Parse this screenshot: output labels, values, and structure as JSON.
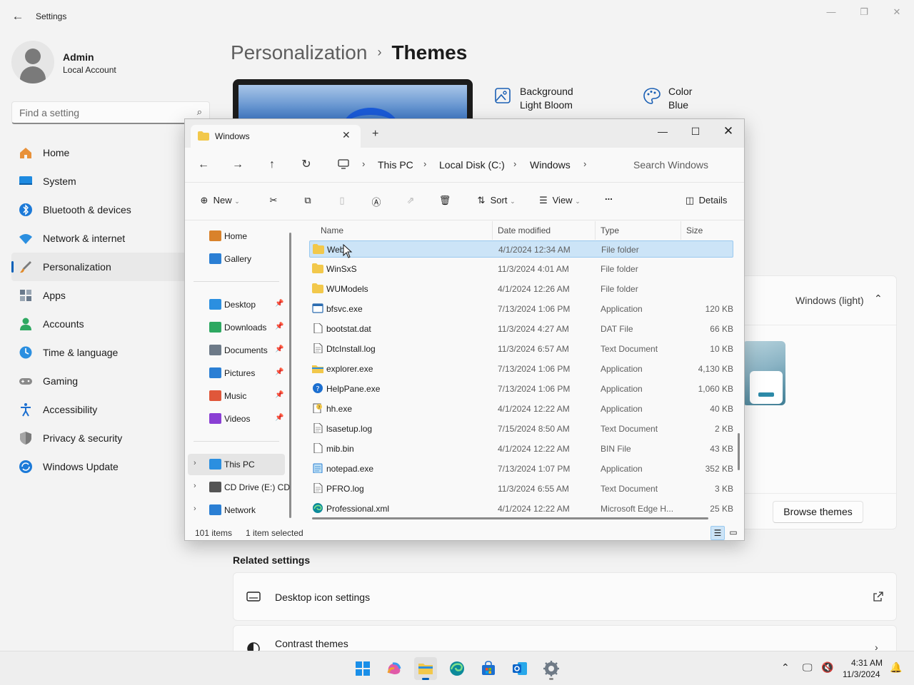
{
  "settings": {
    "window_title": "Settings",
    "profile": {
      "name": "Admin",
      "account_type": "Local Account"
    },
    "search": {
      "placeholder": "Find a setting"
    },
    "nav": [
      {
        "label": "Home",
        "icon": "home-icon",
        "color": "#e8913a"
      },
      {
        "label": "System",
        "icon": "system-icon",
        "color": "#1e8ae0"
      },
      {
        "label": "Bluetooth & devices",
        "icon": "bluetooth-icon",
        "color": "#1c7ad8"
      },
      {
        "label": "Network & internet",
        "icon": "wifi-icon",
        "color": "#2b8fe0"
      },
      {
        "label": "Personalization",
        "icon": "brush-icon",
        "color": "#e08a2a"
      },
      {
        "label": "Apps",
        "icon": "apps-icon",
        "color": "#6a7a8c"
      },
      {
        "label": "Accounts",
        "icon": "accounts-icon",
        "color": "#2ea861"
      },
      {
        "label": "Time & language",
        "icon": "globe-clock-icon",
        "color": "#2b8fe0"
      },
      {
        "label": "Gaming",
        "icon": "gamepad-icon",
        "color": "#8a8a8a"
      },
      {
        "label": "Accessibility",
        "icon": "accessibility-icon",
        "color": "#1c6fd0"
      },
      {
        "label": "Privacy & security",
        "icon": "shield-icon",
        "color": "#7a7a7a"
      },
      {
        "label": "Windows Update",
        "icon": "update-icon",
        "color": "#1c7ad8"
      }
    ],
    "active_nav_index": 4,
    "breadcrumb": {
      "parent": "Personalization",
      "separator": "›",
      "current": "Themes"
    },
    "current_theme": {
      "background_label": "Background",
      "background_value": "Light Bloom",
      "color_label": "Color",
      "color_value": "Blue"
    },
    "theme_section": {
      "current": "Windows (light)",
      "browse_label": "Browse themes"
    },
    "related": {
      "title": "Related settings",
      "items": [
        {
          "label": "Desktop icon settings",
          "icon": "monitor-icon",
          "action": "external-link-icon"
        },
        {
          "label": "Contrast themes",
          "icon": "contrast-icon",
          "action": "chevron-right-icon"
        }
      ]
    }
  },
  "explorer": {
    "tab_label": "Windows",
    "breadcrumb": [
      "This PC",
      "Local Disk (C:)",
      "Windows"
    ],
    "search_placeholder": "Search Windows",
    "toolbar": {
      "new_label": "New",
      "sort_label": "Sort",
      "view_label": "View",
      "more_label": "...",
      "details_label": "Details"
    },
    "nav": {
      "quick": [
        {
          "label": "Home",
          "icon": "home-icon"
        },
        {
          "label": "Gallery",
          "icon": "gallery-icon"
        }
      ],
      "pinned": [
        {
          "label": "Desktop",
          "icon": "desktop-icon"
        },
        {
          "label": "Downloads",
          "icon": "download-icon"
        },
        {
          "label": "Documents",
          "icon": "documents-icon"
        },
        {
          "label": "Pictures",
          "icon": "pictures-icon"
        },
        {
          "label": "Music",
          "icon": "music-icon"
        },
        {
          "label": "Videos",
          "icon": "videos-icon"
        }
      ],
      "drives": [
        {
          "label": "This PC",
          "icon": "computer-icon",
          "selected": true
        },
        {
          "label": "CD Drive (E:) CD",
          "icon": "cd-drive-icon",
          "selected": false
        },
        {
          "label": "Network",
          "icon": "network-icon",
          "selected": false
        }
      ]
    },
    "columns": [
      "Name",
      "Date modified",
      "Type",
      "Size"
    ],
    "rows": [
      {
        "name": "Web",
        "date": "4/1/2024 12:34 AM",
        "type": "File folder",
        "size": "",
        "icon": "folder-icon",
        "selected": true
      },
      {
        "name": "WinSxS",
        "date": "11/3/2024 4:01 AM",
        "type": "File folder",
        "size": "",
        "icon": "folder-icon"
      },
      {
        "name": "WUModels",
        "date": "4/1/2024 12:26 AM",
        "type": "File folder",
        "size": "",
        "icon": "folder-icon"
      },
      {
        "name": "bfsvc.exe",
        "date": "7/13/2024 1:06 PM",
        "type": "Application",
        "size": "120 KB",
        "icon": "app-icon"
      },
      {
        "name": "bootstat.dat",
        "date": "11/3/2024 4:27 AM",
        "type": "DAT File",
        "size": "66 KB",
        "icon": "file-icon"
      },
      {
        "name": "DtcInstall.log",
        "date": "11/3/2024 6:57 AM",
        "type": "Text Document",
        "size": "10 KB",
        "icon": "text-file-icon"
      },
      {
        "name": "explorer.exe",
        "date": "7/13/2024 1:06 PM",
        "type": "Application",
        "size": "4,130 KB",
        "icon": "explorer-icon"
      },
      {
        "name": "HelpPane.exe",
        "date": "7/13/2024 1:06 PM",
        "type": "Application",
        "size": "1,060 KB",
        "icon": "help-icon"
      },
      {
        "name": "hh.exe",
        "date": "4/1/2024 12:22 AM",
        "type": "Application",
        "size": "40 KB",
        "icon": "help-file-icon"
      },
      {
        "name": "lsasetup.log",
        "date": "7/15/2024 8:50 AM",
        "type": "Text Document",
        "size": "2 KB",
        "icon": "text-file-icon"
      },
      {
        "name": "mib.bin",
        "date": "4/1/2024 12:22 AM",
        "type": "BIN File",
        "size": "43 KB",
        "icon": "file-icon"
      },
      {
        "name": "notepad.exe",
        "date": "7/13/2024 1:07 PM",
        "type": "Application",
        "size": "352 KB",
        "icon": "notepad-icon"
      },
      {
        "name": "PFRO.log",
        "date": "11/3/2024 6:55 AM",
        "type": "Text Document",
        "size": "3 KB",
        "icon": "text-file-icon"
      },
      {
        "name": "Professional.xml",
        "date": "4/1/2024 12:22 AM",
        "type": "Microsoft Edge H...",
        "size": "25 KB",
        "icon": "edge-doc-icon"
      }
    ],
    "status": {
      "count": "101 items",
      "selection": "1 item selected"
    }
  },
  "taskbar": {
    "apps": [
      "windows-start-icon",
      "copilot-icon",
      "file-explorer-icon",
      "edge-icon",
      "store-icon",
      "outlook-icon",
      "settings-gear-icon"
    ],
    "time": "4:31 AM",
    "date": "11/3/2024"
  },
  "colors": {
    "accent": "#005fb8",
    "selection": "#cce4f7",
    "folder": "#f2c84b"
  }
}
